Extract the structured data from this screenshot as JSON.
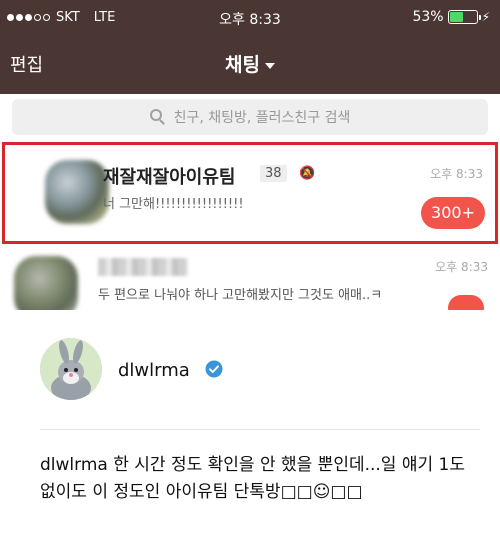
{
  "status": {
    "carrier": "SKT",
    "network": "LTE",
    "time": "오후 8:33",
    "battery": "53%",
    "battery_level": 0.53
  },
  "nav": {
    "edit_label": "편집",
    "title": "채팅"
  },
  "search": {
    "placeholder": "친구, 채팅방, 플러스친구 검색"
  },
  "chats": [
    {
      "name": "재잘재잘아이유팀",
      "member_count": "38",
      "message": "너 그만해!!!!!!!!!!!!!!!!!",
      "time": "오후 8:33",
      "unread": "300+"
    },
    {
      "message": "두 편으로 나눠야 하나 고만해봤지만 그것도 애매..ㅋ",
      "time": "오후 8:33"
    }
  ],
  "tweet": {
    "username": "dlwlrma",
    "text": "dlwlrma 한 시간 정도 확인을 안 했을 뿐인데...일 얘기 1도 없이도 이 정도인 아이유팀 단톡방□□☺□□"
  },
  "colors": {
    "header_bg": "#4a3633",
    "highlight_border": "#d8262b",
    "unread_badge": "#f2544b",
    "verified_blue": "#3b94d9"
  }
}
